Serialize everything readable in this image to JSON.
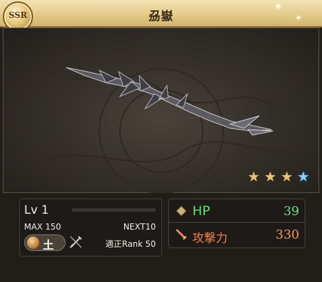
{
  "weapon": {
    "rarity": "SSR",
    "name": "刕嶽"
  },
  "stars": {
    "filled": 3,
    "extra": 1,
    "total": 4
  },
  "level": {
    "label": "Lv 1",
    "max": "MAX 150",
    "next": "NEXT10",
    "exp_progress": 0
  },
  "element": {
    "kanji": "土"
  },
  "rank": "適正Rank 50",
  "stats": {
    "hp_label": "HP",
    "hp_value": "39",
    "atk_label": "攻撃力",
    "atk_value": "330"
  },
  "colors": {
    "hp": "#58e36a",
    "atk": "#f07c5a",
    "header_gold": "#e7cf91",
    "star_gold": "#e5c27a",
    "star_blue": "#8ecff5"
  },
  "icons": [
    "rarity-ssr-badge",
    "sparkle-icon",
    "diamond-icon",
    "sword-icon",
    "earth-element-icon",
    "weapon-type-icon",
    "star-icon"
  ]
}
